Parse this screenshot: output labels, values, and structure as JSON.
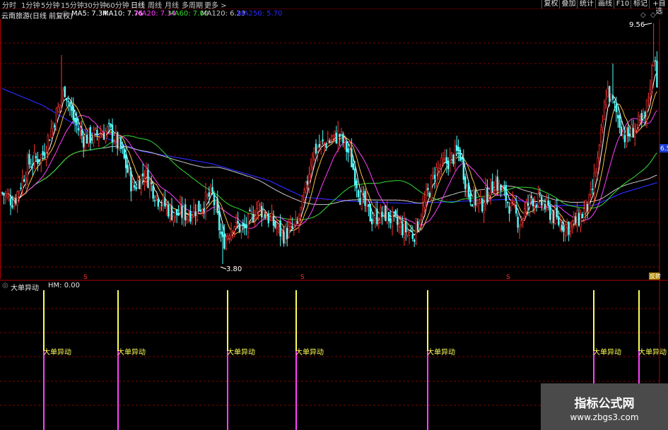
{
  "toolbar": {
    "periods": [
      "分时",
      "1分钟",
      "5分钟",
      "15分钟",
      "30分钟",
      "60分钟",
      "日线",
      "周线",
      "月线",
      "多周期",
      "更多 >"
    ],
    "active_period": "日线",
    "right_buttons": [
      "复权",
      "叠加",
      "统计",
      "画线",
      "F10",
      "标记",
      "+自选"
    ]
  },
  "info": {
    "stock": "云南旅游(日线 前复权)",
    "ma": [
      {
        "label": "MA5: 7.34",
        "color": "#ffffff"
      },
      {
        "label": "MA10: 7.76",
        "color": "#ffffff"
      },
      {
        "label": "MA20: 7.34",
        "color": "#ff40ff"
      },
      {
        "label": "MA60: 7.00",
        "color": "#33dd33"
      },
      {
        "label": "MA120: 6.23",
        "color": "#c8c8c8"
      },
      {
        "label": "MA250: 5.70",
        "color": "#2a2aff"
      }
    ]
  },
  "chart_data": [
    {
      "type": "candlestick",
      "title": "云南旅游(日线 前复权)",
      "annotations": {
        "high_label": "9.56",
        "low_label": "3.80",
        "price_tag": "6.5",
        "marker": "S",
        "corner_tag": "反转"
      },
      "moving_averages": {
        "MA5": 7.34,
        "MA10": 7.76,
        "MA20": 7.34,
        "MA60": 7.0,
        "MA120": 6.23,
        "MA250": 5.7
      },
      "grid": true
    },
    {
      "type": "bar",
      "title": "大单异动",
      "value_label": "HM: 0.00",
      "signal_label": "大单异动",
      "signal_count": 7
    }
  ],
  "indicator": {
    "name": "大单异动",
    "hm": "HM: 0.00"
  },
  "watermark": {
    "title": "指标公式网",
    "url": "www.zbgs3.com"
  },
  "colors": {
    "up": "#ff3232",
    "down": "#54fcfc",
    "grid": "#7a0000",
    "signal_top": "#ffff55",
    "signal_bottom": "#ff40ff"
  }
}
